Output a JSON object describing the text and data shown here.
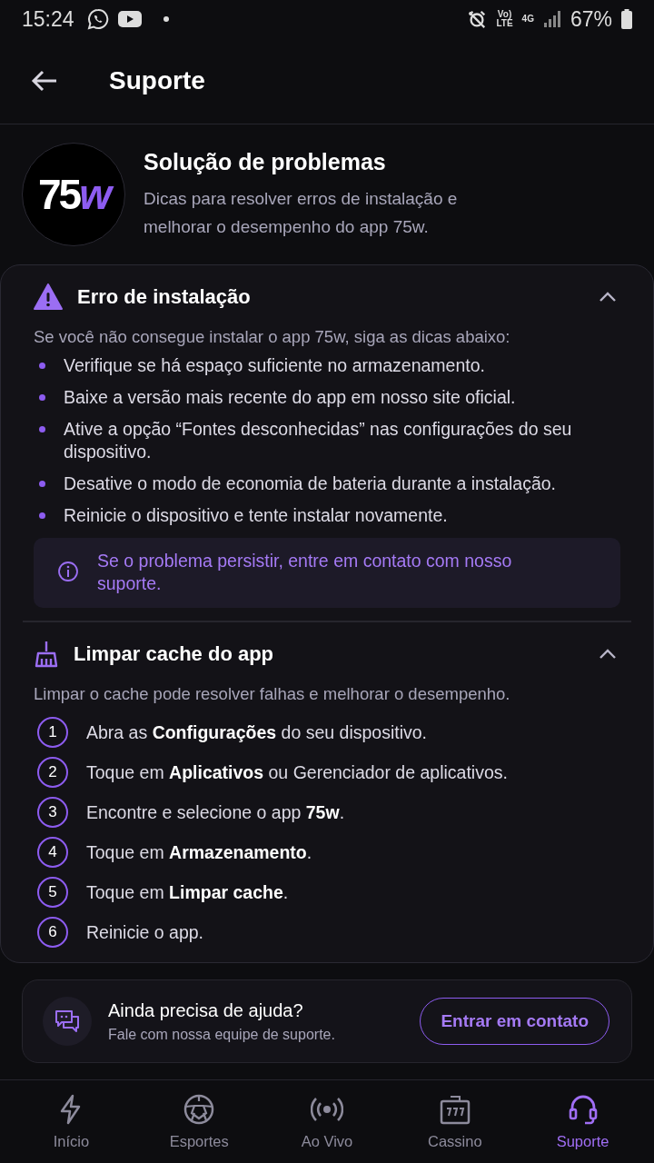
{
  "status_bar": {
    "time": "15:24",
    "volte": [
      "Vo)",
      "LTE"
    ],
    "network": "4G",
    "battery": "67%"
  },
  "header": {
    "title": "Suporte"
  },
  "intro": {
    "logo": {
      "main": "75",
      "accent": "w"
    },
    "title": "Solução de problemas",
    "description": "Dicas para resolver erros de instalação e melhorar o desempenho do app 75w."
  },
  "sections": [
    {
      "kind": "bullets",
      "title": "Erro de instalação",
      "expanded": true,
      "lead": "Se você não consegue instalar o app 75w, siga as dicas abaixo:",
      "items": [
        "Verifique se há espaço suficiente no armazenamento.",
        "Baixe a versão mais recente do app em nosso site oficial.",
        "Ative a opção “Fontes desconhecidas” nas configurações do seu dispositivo.",
        "Desative o modo de economia de bateria durante a instalação.",
        "Reinicie o dispositivo e tente instalar novamente."
      ],
      "note": "Se o problema persistir, entre em contato com nosso suporte."
    },
    {
      "kind": "steps",
      "title": "Limpar cache do app",
      "expanded": true,
      "lead": "Limpar o cache pode resolver falhas e melhorar o desempenho.",
      "items": [
        {
          "number": "1",
          "text": "Abra as **Configurações** do seu dispositivo."
        },
        {
          "number": "2",
          "text": "Toque em **Aplicativos** ou Gerenciador de aplicativos."
        },
        {
          "number": "3",
          "text": "Encontre e selecione o app **75w**."
        },
        {
          "number": "4",
          "text": "Toque em **Armazenamento**."
        },
        {
          "number": "5",
          "text": "Toque em **Limpar cache**."
        },
        {
          "number": "6",
          "text": "Reinicie o app."
        }
      ]
    }
  ],
  "help": {
    "title": "Ainda precisa de ajuda?",
    "subtitle": "Fale com nossa equipe de suporte.",
    "button": "Entrar em contato"
  },
  "nav": [
    {
      "label": "Início",
      "selected": false
    },
    {
      "label": "Esportes",
      "selected": false
    },
    {
      "label": "Ao Vivo",
      "selected": false
    },
    {
      "label": "Cassino",
      "selected": false
    },
    {
      "label": "Suporte",
      "selected": true
    }
  ]
}
